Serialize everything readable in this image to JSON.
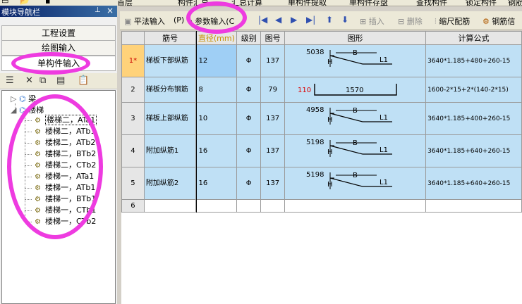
{
  "menubar": {
    "floor_select": "首层",
    "items": [
      "构件汇总",
      "汇总计算",
      "单构件提取",
      "单构件存盘",
      "查找构件",
      "锁定构件",
      "钢筋信"
    ]
  },
  "nav_panel": {
    "title": "模块导航栏",
    "pin": " ",
    "close": "×",
    "buttons": [
      "工程设置",
      "绘图输入",
      "单构件输入"
    ],
    "active_button": "单构件输入"
  },
  "tree": {
    "root_beam": "梁",
    "root_stairs": "楼梯",
    "leaves": [
      "楼梯二，ATa1",
      "楼梯二，ATb1",
      "楼梯二，ATb2",
      "楼梯二，BTb2",
      "楼梯二，CTb2",
      "楼梯一，ATa1",
      "楼梯一，ATb1",
      "楼梯一，BTb1",
      "楼梯一，CTb1",
      "楼梯一，CTb2"
    ],
    "selected_leaf": "楼梯二，ATa1"
  },
  "toolbar": {
    "flat_input": "平法输入",
    "p_key": "(P)",
    "param_input": "参数输入(C",
    "insert": "插入",
    "delete": "删除",
    "scale_rebar": "缩尺配筋",
    "rebar_info": "钢筋信"
  },
  "grid": {
    "headers": [
      "",
      "筋号",
      "直径(mm)",
      "级别",
      "图号",
      "图形",
      "计算公式"
    ],
    "rows": [
      {
        "num": "1*",
        "name": "梯板下部纵筋",
        "dia": "12",
        "grade": "Φ",
        "fig_no": "137",
        "shape": "bent",
        "shape_top": "5038",
        "formula": "3640*1.185+480+260-15"
      },
      {
        "num": "2",
        "name": "梯板分布钢筋",
        "dia": "8",
        "grade": "Φ",
        "fig_no": "79",
        "shape": "hook",
        "shape_left": "110",
        "shape_mid": "1570",
        "formula": "1600-2*15+2*(140-2*15)"
      },
      {
        "num": "3",
        "name": "梯板上部纵筋",
        "dia": "10",
        "grade": "Φ",
        "fig_no": "137",
        "shape": "bent",
        "shape_top": "4958",
        "formula": "3640*1.185+400+260-15"
      },
      {
        "num": "4",
        "name": "附加纵筋1",
        "dia": "16",
        "grade": "Φ",
        "fig_no": "137",
        "shape": "bent",
        "shape_top": "5198",
        "formula": "3640*1.185+640+260-15"
      },
      {
        "num": "5",
        "name": "附加纵筋2",
        "dia": "16",
        "grade": "Φ",
        "fig_no": "137",
        "shape": "bent",
        "shape_top": "5198",
        "formula": "3640*1.185+640+260-15"
      },
      {
        "num": "6",
        "name": "",
        "dia": "",
        "grade": "",
        "fig_no": "",
        "shape": "",
        "formula": ""
      }
    ],
    "shape_labels": {
      "b": "B",
      "h": "H",
      "l1": "L1"
    }
  },
  "colors": {
    "highlight_ring": "#ee3be0",
    "row_fill": "#bfe0f5",
    "current_row": "#ffd27a"
  }
}
